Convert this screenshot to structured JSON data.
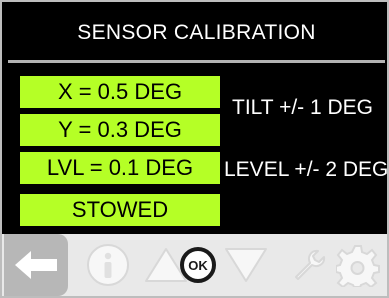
{
  "header": {
    "title": "SENSOR CALIBRATION"
  },
  "readouts": [
    {
      "label": "X = 0.5 DEG"
    },
    {
      "label": "Y = 0.3 DEG"
    },
    {
      "label": "LVL = 0.1 DEG"
    },
    {
      "label": "STOWED"
    }
  ],
  "tolerances": [
    {
      "label": "TILT +/- 1 DEG"
    },
    {
      "label": "LEVEL +/- 2 DEG"
    }
  ],
  "nav": {
    "ok_label": "OK",
    "icons": [
      "back-arrow-icon",
      "info-icon",
      "up-triangle-icon",
      "ok-icon",
      "down-triangle-icon",
      "wrench-icon",
      "gear-icon"
    ]
  },
  "colors": {
    "background": "#000000",
    "readout_fill": "#b5ff26",
    "title_text": "#ffffff",
    "nav_background": "#e9e9e9",
    "back_button": "#b7b7b7",
    "icon_faded": "#f5f5f5"
  }
}
